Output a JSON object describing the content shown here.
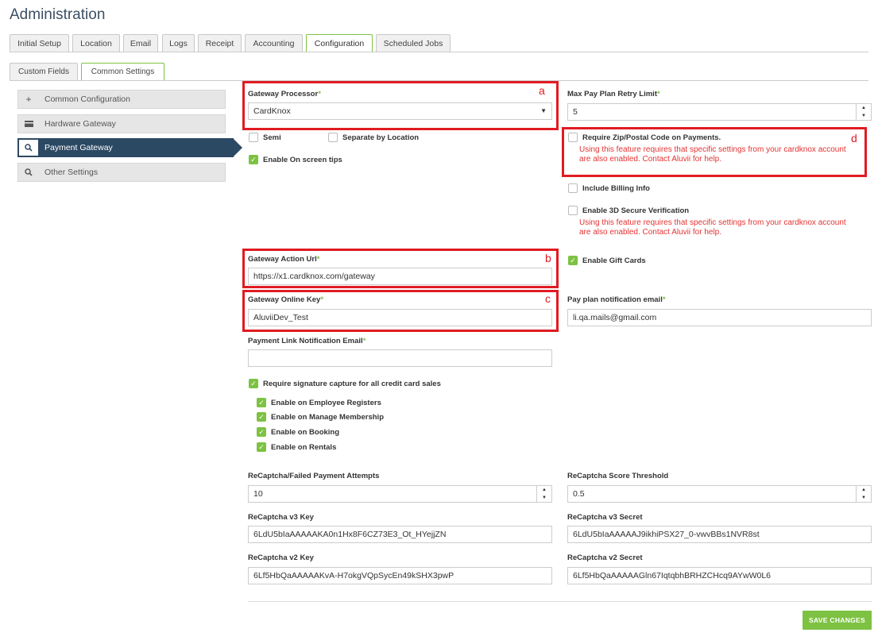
{
  "page": {
    "title": "Administration"
  },
  "tabs": [
    {
      "label": "Initial Setup"
    },
    {
      "label": "Location"
    },
    {
      "label": "Email"
    },
    {
      "label": "Logs"
    },
    {
      "label": "Receipt"
    },
    {
      "label": "Accounting"
    },
    {
      "label": "Configuration"
    },
    {
      "label": "Scheduled Jobs"
    }
  ],
  "subtabs": [
    {
      "label": "Custom Fields"
    },
    {
      "label": "Common Settings"
    }
  ],
  "sidebar": {
    "items": [
      {
        "label": "Common Configuration",
        "icon": "plus-icon"
      },
      {
        "label": "Hardware Gateway",
        "icon": "card-icon"
      },
      {
        "label": "Payment Gateway",
        "icon": "search-icon"
      },
      {
        "label": "Other Settings",
        "icon": "search-icon"
      }
    ]
  },
  "left": {
    "gateway_processor": {
      "label": "Gateway Processor",
      "value": "CardKnox"
    },
    "semi": "Semi",
    "separate_by_location": "Separate by Location",
    "enable_onscreen_tips": "Enable On screen tips",
    "gateway_action_url": {
      "label": "Gateway Action Url",
      "value": "https://x1.cardknox.com/gateway"
    },
    "gateway_online_key": {
      "label": "Gateway Online Key",
      "value": "AluviiDev_Test"
    },
    "payment_link_email": {
      "label": "Payment Link Notification Email",
      "value": ""
    },
    "require_signature": "Require signature capture for all credit card sales",
    "enable_employee_registers": "Enable on Employee Registers",
    "enable_manage_membership": "Enable on Manage Membership",
    "enable_booking": "Enable on Booking",
    "enable_rentals": "Enable on Rentals",
    "recaptcha_failed_attempts": {
      "label": "ReCaptcha/Failed Payment Attempts",
      "value": "10"
    },
    "recaptcha_v3_key": {
      "label": "ReCaptcha v3 Key",
      "value": "6LdU5bIaAAAAAKA0n1Hx8F6CZ73E3_Ot_HYejjZN"
    },
    "recaptcha_v2_key": {
      "label": "ReCaptcha v2 Key",
      "value": "6Lf5HbQaAAAAAKvA-H7okgVQpSycEn49kSHX3pwP"
    }
  },
  "right": {
    "max_pay_plan_retry": {
      "label": "Max Pay Plan Retry Limit",
      "value": "5"
    },
    "require_zip": "Require Zip/Postal Code on Payments.",
    "zip_warning": "Using this feature requires that specific settings from your cardknox account are also enabled. Contact Aluvii for help.",
    "include_billing": "Include Billing Info",
    "enable_3d": "Enable 3D Secure Verification",
    "three_d_warning": "Using this feature requires that specific settings from your cardknox account are also enabled. Contact Aluvii for help.",
    "enable_gift_cards": "Enable Gift Cards",
    "pay_plan_email": {
      "label": "Pay plan notification email",
      "value": "li.qa.mails@gmail.com"
    },
    "recaptcha_score": {
      "label": "ReCaptcha Score Threshold",
      "value": "0.5"
    },
    "recaptcha_v3_secret": {
      "label": "ReCaptcha v3 Secret",
      "value": "6LdU5bIaAAAAAJ9ikhiPSX27_0-vwvBBs1NVR8st"
    },
    "recaptcha_v2_secret": {
      "label": "ReCaptcha v2 Secret",
      "value": "6Lf5HbQaAAAAAGln67IqtqbhBRHZCHcq9AYwW0L6"
    }
  },
  "annotations": {
    "a": "a",
    "b": "b",
    "c": "c",
    "d": "d"
  },
  "save_label": "SAVE CHANGES",
  "colors": {
    "accent": "#7dc242",
    "nav_active": "#2c4963",
    "annotation": "#e01b22",
    "warning": "#e53333"
  }
}
